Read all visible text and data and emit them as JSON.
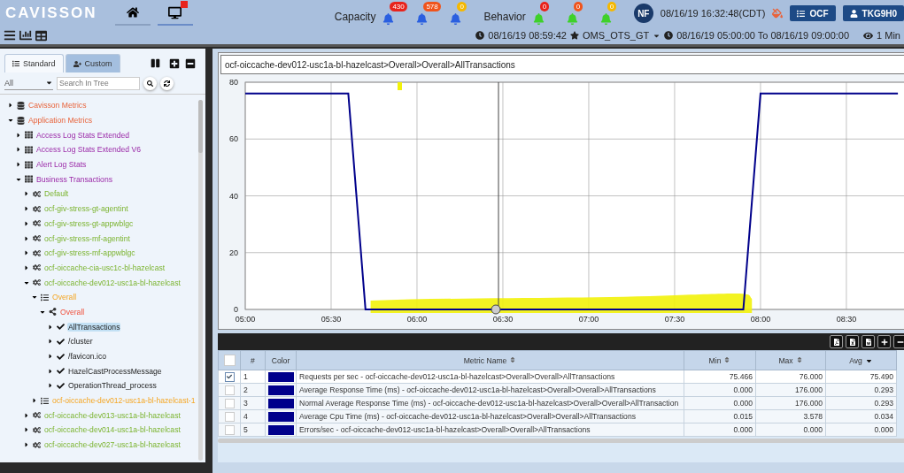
{
  "header": {
    "logo": "CAVISSON",
    "nav": [
      {
        "kind": "home",
        "selected": false
      },
      {
        "kind": "monitor",
        "selected": true
      }
    ],
    "alert_groups": [
      {
        "label": "Capacity",
        "kind": "capacity",
        "bells": [
          {
            "count": "430",
            "color": "#e8231c"
          },
          {
            "count": "578",
            "color": "#f0541c"
          },
          {
            "count": "0",
            "color": "#f5b800"
          }
        ]
      },
      {
        "label": "Behavior",
        "kind": "behavior",
        "bells": [
          {
            "count": "0",
            "color": "#e8231c"
          },
          {
            "count": "0",
            "color": "#f0541c"
          },
          {
            "count": "0",
            "color": "#f5b800"
          }
        ]
      }
    ],
    "user_initials": "NF",
    "datetime": "08/16/19 16:32:48(CDT)",
    "buttons": [
      {
        "kind": "list",
        "label": "OCF"
      },
      {
        "kind": "user",
        "label": "TKG9H0"
      }
    ]
  },
  "toolbar": {
    "current_time": "08/16/19 08:59:42",
    "profile": "OMS_OTS_GT",
    "range": "08/16/19 05:00:00 To 08/16/19 09:00:00",
    "interval": "1 Min"
  },
  "sidebar": {
    "tabs": [
      {
        "label": "Standard",
        "selected": true
      },
      {
        "label": "Custom",
        "selected": false
      }
    ],
    "filter": "All",
    "search": {
      "placeholder": "Search In Tree"
    },
    "tree": [
      {
        "label": "Cavisson Metrics",
        "kind": "db",
        "expanded": false,
        "selected": false
      },
      {
        "label": "Application Metrics",
        "kind": "db",
        "expanded": true,
        "selected": false,
        "children": [
          {
            "label": "Access Log Stats Extended",
            "kind": "grid",
            "expanded": false,
            "selected": false
          },
          {
            "label": "Access Log Stats Extended V6",
            "kind": "grid",
            "expanded": false,
            "selected": false
          },
          {
            "label": "Alert Log Stats",
            "kind": "grid",
            "expanded": false,
            "selected": false
          },
          {
            "label": "Business Transactions",
            "kind": "grid",
            "expanded": true,
            "selected": false,
            "children": [
              {
                "label": "Default",
                "kind": "gears",
                "expanded": false,
                "selected": false
              },
              {
                "label": "ocf-giv-stress-gt-agentint",
                "kind": "gears",
                "expanded": false,
                "selected": false
              },
              {
                "label": "ocf-giv-stress-gt-appwblgc",
                "kind": "gears",
                "expanded": false,
                "selected": false
              },
              {
                "label": "ocf-giv-stress-mf-agentint",
                "kind": "gears",
                "expanded": false,
                "selected": false
              },
              {
                "label": "ocf-giv-stress-mf-appwblgc",
                "kind": "gears",
                "expanded": false,
                "selected": false
              },
              {
                "label": "ocf-oiccache-cia-usc1c-bl-hazelcast",
                "kind": "gears",
                "expanded": false,
                "selected": false
              },
              {
                "label": "ocf-oiccache-dev012-usc1a-bl-hazelcast",
                "kind": "gears",
                "expanded": true,
                "selected": false,
                "children": [
                  {
                    "label": "Overall",
                    "kind": "list",
                    "expanded": true,
                    "selected": false,
                    "children": [
                      {
                        "label": "Overall",
                        "kind": "share",
                        "expanded": true,
                        "selected": false,
                        "children": [
                          {
                            "label": "AllTransactions",
                            "kind": "check",
                            "expanded": false,
                            "selected": true
                          },
                          {
                            "label": "/cluster",
                            "kind": "check",
                            "expanded": false,
                            "selected": false
                          },
                          {
                            "label": "/favicon.ico",
                            "kind": "check",
                            "expanded": false,
                            "selected": false
                          },
                          {
                            "label": "HazelCastProcessMessage",
                            "kind": "check",
                            "expanded": false,
                            "selected": false
                          },
                          {
                            "label": "OperationThread_process",
                            "kind": "check",
                            "expanded": false,
                            "selected": false
                          }
                        ]
                      }
                    ]
                  },
                  {
                    "label": "ocf-oiccache-dev012-usc1a-bl-hazelcast-1",
                    "kind": "list",
                    "expanded": false,
                    "selected": false
                  }
                ]
              },
              {
                "label": "ocf-oiccache-dev013-usc1a-bl-hazelcast",
                "kind": "gears",
                "expanded": false,
                "selected": false
              },
              {
                "label": "ocf-oiccache-dev014-usc1a-bl-hazelcast",
                "kind": "gears",
                "expanded": false,
                "selected": false
              },
              {
                "label": "ocf-oiccache-dev027-usc1a-bl-hazelcast",
                "kind": "gears",
                "expanded": false,
                "selected": false
              }
            ]
          }
        ]
      }
    ]
  },
  "chart": {
    "title": "ocf-oiccache-dev012-usc1a-bl-hazelcast>Overall>Overall>AllTransactions",
    "chart_data": {
      "type": "line",
      "grid": true,
      "categories": [
        "05:00",
        null,
        null,
        null,
        null,
        "05:30",
        null,
        null,
        null,
        null,
        "06:00",
        null,
        null,
        null,
        null,
        "06:30",
        null,
        null,
        null,
        null,
        "07:00",
        null,
        null,
        null,
        null,
        "07:30",
        null,
        null,
        null,
        null,
        "08:00",
        null,
        null,
        null,
        null,
        "08:30",
        null,
        null,
        null
      ],
      "ylim": [
        0,
        80
      ],
      "yticks": [
        0,
        20,
        40,
        60,
        80
      ],
      "series": [
        {
          "color": "#00008b",
          "values": [
            76,
            76,
            76,
            76,
            76,
            76,
            76,
            0,
            0,
            0,
            0,
            0,
            0,
            0,
            0,
            0,
            0,
            0,
            0,
            0,
            0,
            0,
            0,
            0,
            0,
            0,
            0,
            0,
            0,
            0,
            76,
            76,
            76,
            76,
            76,
            76,
            76,
            76,
            76
          ]
        }
      ]
    }
  },
  "table": {
    "header_checked": false,
    "columns": [
      {
        "label": "#",
        "sortable": false
      },
      {
        "label": "Color",
        "sortable": false
      },
      {
        "label": "Metric Name",
        "sortable": true,
        "sorted_desc": false
      },
      {
        "label": "Min",
        "sortable": true,
        "sorted_desc": false
      },
      {
        "label": "Max",
        "sortable": true,
        "sorted_desc": false
      },
      {
        "label": "Avg",
        "sortable": true,
        "sorted_desc": true
      }
    ],
    "rows": [
      {
        "checked": true,
        "num": "1",
        "color": "#00008b",
        "name": "Requests per sec - ocf-oiccache-dev012-usc1a-bl-hazelcast>Overall>Overall>AllTransactions",
        "min": "75.466",
        "max": "76.000",
        "avg": "75.490"
      },
      {
        "checked": false,
        "num": "2",
        "color": "#00008b",
        "name": "Average Response Time (ms) - ocf-oiccache-dev012-usc1a-bl-hazelcast>Overall>Overall>AllTransactions",
        "min": "0.000",
        "max": "176.000",
        "avg": "0.293"
      },
      {
        "checked": false,
        "num": "3",
        "color": "#00008b",
        "name": "Normal Average Response Time (ms) - ocf-oiccache-dev012-usc1a-bl-hazelcast>Overall>Overall>AllTransaction",
        "min": "0.000",
        "max": "176.000",
        "avg": "0.293"
      },
      {
        "checked": false,
        "num": "4",
        "color": "#00008b",
        "name": "Average Cpu Time (ms) - ocf-oiccache-dev012-usc1a-bl-hazelcast>Overall>Overall>AllTransactions",
        "min": "0.015",
        "max": "3.578",
        "avg": "0.034"
      },
      {
        "checked": false,
        "num": "5",
        "color": "#00008b",
        "name": "Errors/sec - ocf-oiccache-dev012-usc1a-bl-hazelcast>Overall>Overall>AllTransactions",
        "min": "0.000",
        "max": "0.000",
        "avg": "0.000"
      }
    ]
  }
}
